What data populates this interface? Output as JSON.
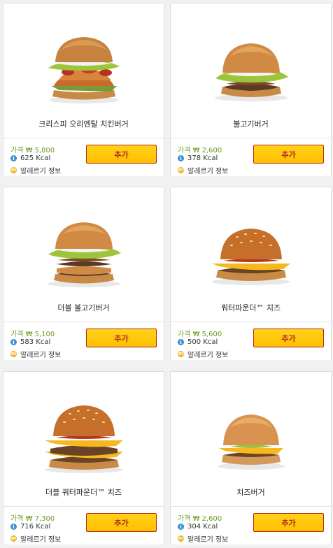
{
  "items": [
    {
      "name": "크리스피 오리엔탈 치킨버거",
      "price": "가격 ₩ 5,800",
      "kcal": "625 Kcal",
      "allergy": "알레르기 정보",
      "add": "추가"
    },
    {
      "name": "불고기버거",
      "price": "가격 ₩ 2,600",
      "kcal": "378 Kcal",
      "allergy": "알레르기 정보",
      "add": "추가"
    },
    {
      "name": "더블 불고기버거",
      "price": "가격 ₩ 5,100",
      "kcal": "583 Kcal",
      "allergy": "알레르기 정보",
      "add": "추가"
    },
    {
      "name": "쿼터파운더™ 치즈",
      "price": "가격 ₩ 5,600",
      "kcal": "500 Kcal",
      "allergy": "알레르기 정보",
      "add": "추가"
    },
    {
      "name": "더블 쿼터파운더™ 치즈",
      "price": "가격 ₩ 7,300",
      "kcal": "716 Kcal",
      "allergy": "알레르기 정보",
      "add": "추가"
    },
    {
      "name": "치즈버거",
      "price": "가격 ₩ 2,600",
      "kcal": "304 Kcal",
      "allergy": "알레르기 정보",
      "add": "추가"
    }
  ]
}
